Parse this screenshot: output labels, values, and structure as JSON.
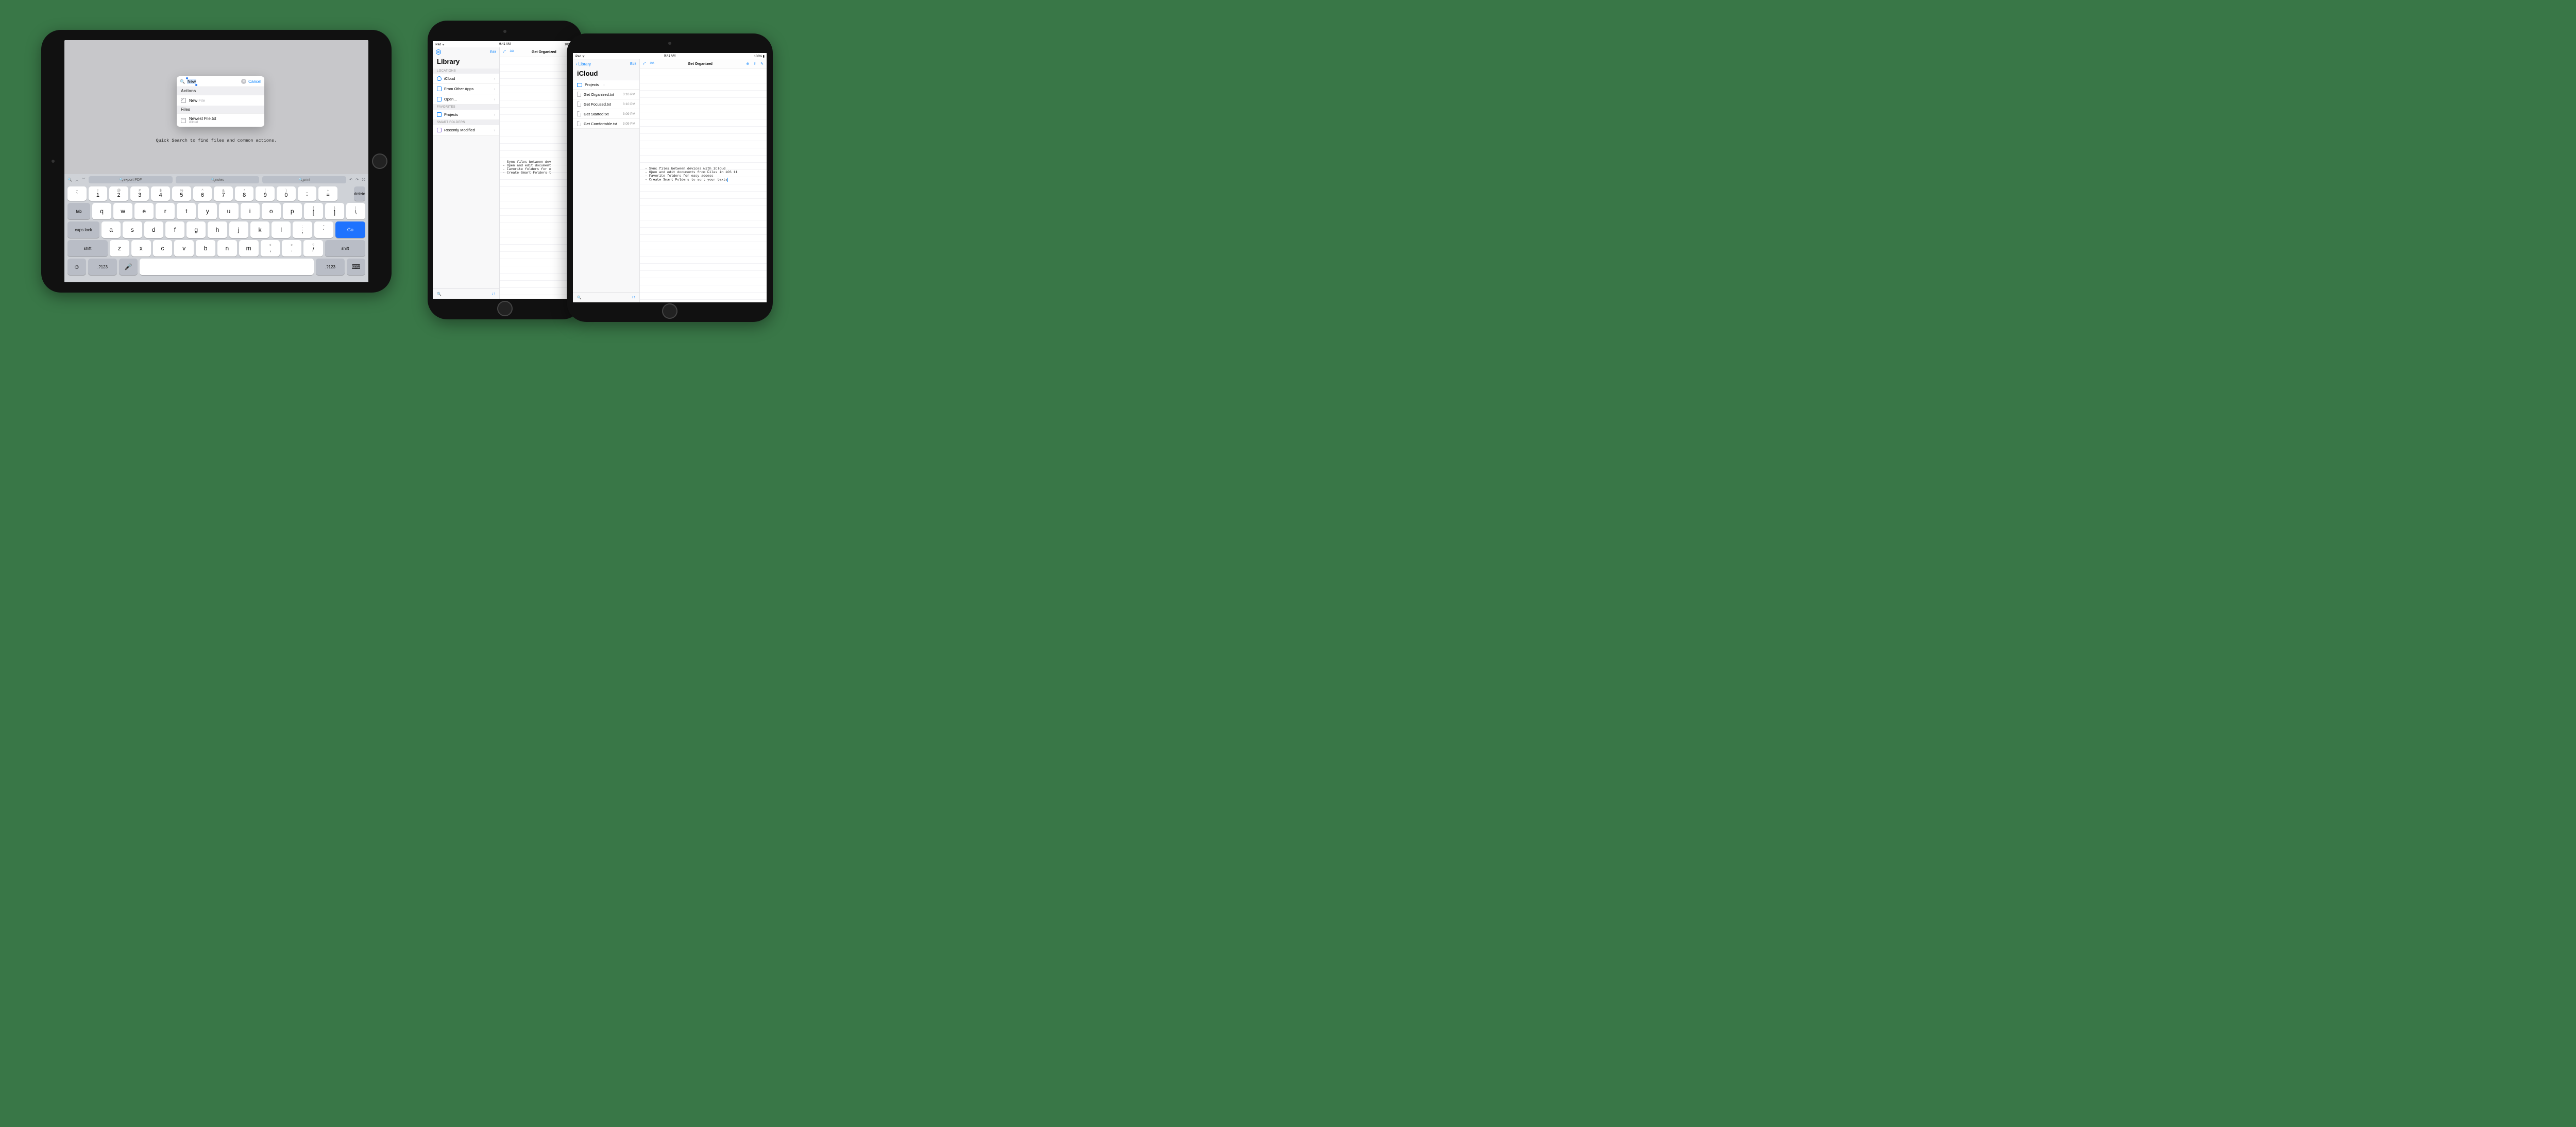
{
  "status": {
    "left": "iPad ᯤ",
    "time": "9:41 AM",
    "right": "100% ▮"
  },
  "d1": {
    "caption": "Quick Search to find files and common actions.",
    "search": {
      "query": "New",
      "cancel": "Cancel",
      "sections": {
        "actions": "Actions",
        "files": "Files"
      },
      "action_row": {
        "prefix": "New ",
        "suffix": "File"
      },
      "file_row": {
        "name": "Newest File.txt",
        "location": "iCloud"
      }
    },
    "toolbar_pills": {
      "a": "export PDF",
      "b": "notes",
      "c": "print"
    },
    "keys": {
      "tab": "tab",
      "caps": "caps lock",
      "shift": "shift",
      "delete": "delete",
      "go": "Go",
      "sym": ".?123",
      "numtop": [
        "~\n`",
        "!\n1",
        "@\n2",
        "#\n3",
        "$\n4",
        "%\n5",
        "^\n6",
        "&\n7",
        "*\n8",
        "(\n9",
        ")\n0",
        "_\n-",
        "+\n="
      ],
      "r1": [
        "q",
        "w",
        "e",
        "r",
        "t",
        "y",
        "u",
        "i",
        "o",
        "p",
        "{\n[",
        "}\n]",
        "|\n\\"
      ],
      "r2": [
        "a",
        "s",
        "d",
        "f",
        "g",
        "h",
        "j",
        "k",
        "l",
        ":\n;",
        "\"\n'"
      ],
      "r3": [
        "z",
        "x",
        "c",
        "v",
        "b",
        "n",
        "m",
        "<\n,",
        ">\n.",
        "?\n/"
      ]
    }
  },
  "d2": {
    "edit": "Edit",
    "title": "Library",
    "sections": {
      "locations": "LOCATIONS",
      "favorites": "FAVORITES",
      "smart": "SMART FOLDERS"
    },
    "locations": [
      "iCloud",
      "From Other Apps",
      "Open…"
    ],
    "favorites": [
      "Projects"
    ],
    "smart": [
      "Recently Modified"
    ],
    "doc_title": "Get Organized",
    "body": "- Sync files between dev\n- Open and edit document\n- Favorite folders for e\n- Create Smart Folders t"
  },
  "d3": {
    "back": "Library",
    "edit": "Edit",
    "title": "iCloud",
    "folder": {
      "name": "Projects"
    },
    "files": [
      {
        "name": "Get Organized.txt",
        "time": "3:10 PM"
      },
      {
        "name": "Get Focused.txt",
        "time": "3:10 PM"
      },
      {
        "name": "Get Started.txt",
        "time": "3:09 PM"
      },
      {
        "name": "Get Comfortable.txt",
        "time": "3:09 PM"
      }
    ],
    "doc_title": "Get Organized",
    "body": "- Sync files between devices with iCloud\n- Open and edit documents from Files in iOS 11\n- Favorite folders for easy access\n- Create Smart Folders to sort your texts"
  }
}
